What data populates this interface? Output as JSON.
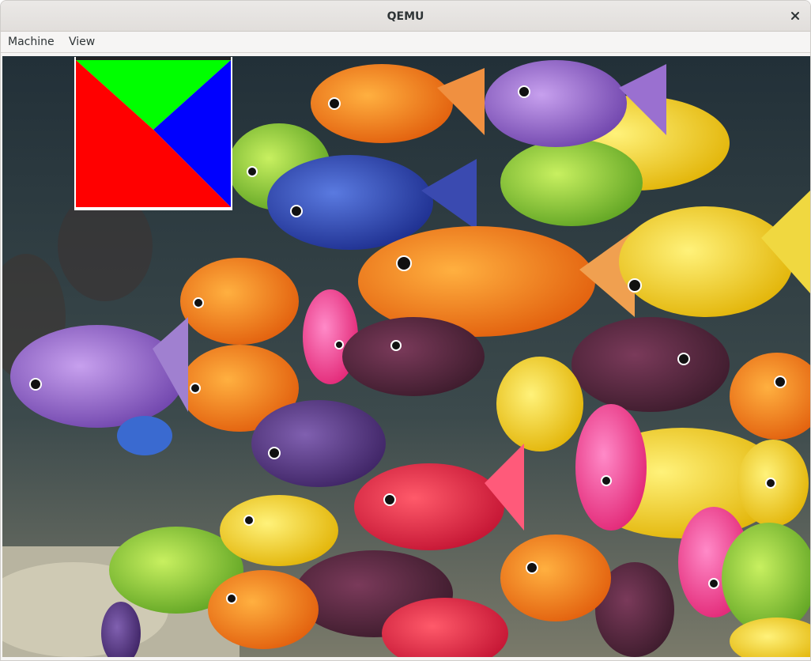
{
  "window": {
    "title": "QEMU",
    "close_icon": "close-icon"
  },
  "menubar": {
    "items": [
      {
        "label": "Machine"
      },
      {
        "label": "View"
      }
    ]
  },
  "display": {
    "content": "guest-display",
    "overlay": {
      "icon": "rgb-triangles-test-image",
      "colors": {
        "top": "#00ff00",
        "right": "#0000ff",
        "left": "#ff0000"
      }
    }
  }
}
